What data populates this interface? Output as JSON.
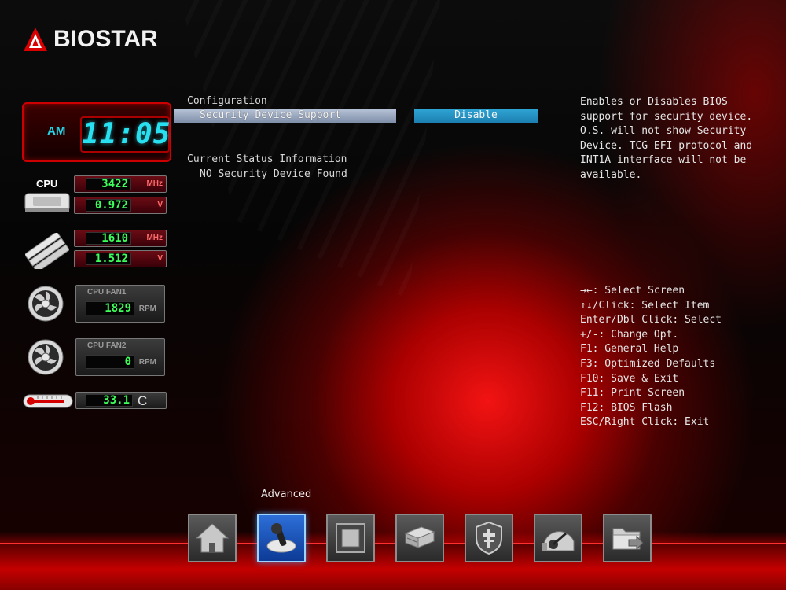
{
  "logo": {
    "text": "BIOSTAR"
  },
  "monitor": {
    "clock": {
      "ampm": "AM",
      "time": "11:05"
    },
    "cpu": {
      "label": "CPU",
      "freq": "3422",
      "freq_unit": "MHz",
      "voltage": "0.972",
      "voltage_unit": "V"
    },
    "memory": {
      "freq": "1610",
      "freq_unit": "MHz",
      "voltage": "1.512",
      "voltage_unit": "V"
    },
    "fan1": {
      "title": "CPU FAN1",
      "value": "1829",
      "unit": "RPM"
    },
    "fan2": {
      "title": "CPU FAN2",
      "value": "0",
      "unit": "RPM"
    },
    "temperature": {
      "value": "33.1",
      "unit": "C"
    }
  },
  "main": {
    "section_title": "Configuration",
    "setting": {
      "label": "Security Device Support",
      "value": "Disable"
    },
    "status_title": "Current Status Information",
    "status_text": "NO Security Device Found"
  },
  "help": {
    "text": "Enables or Disables BIOS support for security device. O.S. will not show Security Device. TCG EFI protocol and INT1A interface will not be available."
  },
  "keys": [
    "→←: Select Screen",
    "↑↓/Click: Select Item",
    "Enter/Dbl Click: Select",
    "+/-: Change Opt.",
    "F1: General Help",
    "F3: Optimized Defaults",
    "F10: Save & Exit",
    "F11: Print Screen",
    "F12: BIOS Flash",
    "ESC/Right Click: Exit"
  ],
  "nav": {
    "active_label": "Advanced",
    "items": [
      {
        "icon": "home-icon",
        "active": false
      },
      {
        "icon": "joystick-icon",
        "active": true
      },
      {
        "icon": "chipset-icon",
        "active": false
      },
      {
        "icon": "boot-drive-icon",
        "active": false
      },
      {
        "icon": "security-shield-icon",
        "active": false
      },
      {
        "icon": "performance-gauge-icon",
        "active": false
      },
      {
        "icon": "save-exit-icon",
        "active": false
      }
    ]
  },
  "colors": {
    "accent_red": "#cc0000",
    "lcd_green": "#3dff5a",
    "clock_cyan": "#29e0f0",
    "selected_row": "#8d9ab3",
    "value_box": "#2fa6d6",
    "active_nav": "#1a5fc8"
  }
}
